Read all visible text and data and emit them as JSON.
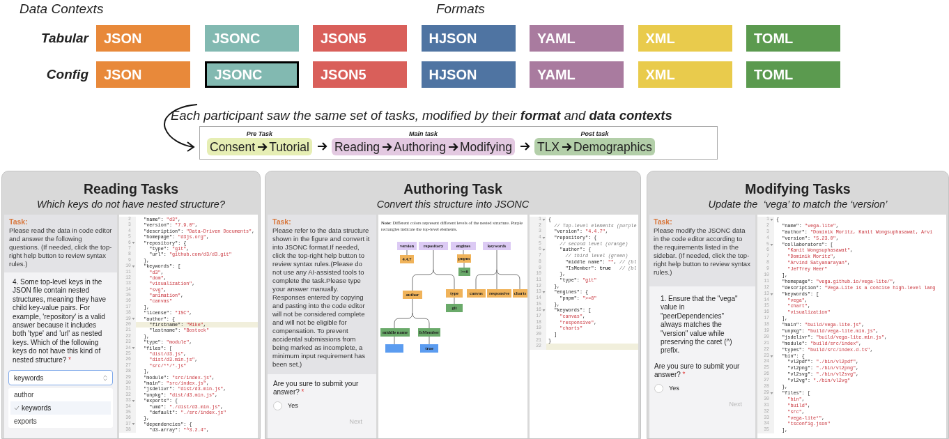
{
  "data_contexts_heading": "Data Contexts",
  "formats_heading": "Formats",
  "contexts": [
    {
      "label": "Tabular",
      "formats": [
        {
          "name": "JSON",
          "color": "#e8893a",
          "selected": false
        },
        {
          "name": "JSONC",
          "color": "#82b9b1",
          "selected": false
        },
        {
          "name": "JSON5",
          "color": "#d95f5a",
          "selected": false
        },
        {
          "name": "HJSON",
          "color": "#4f74a2",
          "selected": false
        },
        {
          "name": "YAML",
          "color": "#a97b9f",
          "selected": false
        },
        {
          "name": "XML",
          "color": "#e9cb4c",
          "selected": false
        },
        {
          "name": "TOML",
          "color": "#5b9a4f",
          "selected": false
        }
      ]
    },
    {
      "label": "Config",
      "formats": [
        {
          "name": "JSON",
          "color": "#e8893a",
          "selected": false
        },
        {
          "name": "JSONC",
          "color": "#82b9b1",
          "selected": true
        },
        {
          "name": "JSON5",
          "color": "#d95f5a",
          "selected": false
        },
        {
          "name": "HJSON",
          "color": "#4f74a2",
          "selected": false
        },
        {
          "name": "YAML",
          "color": "#a97b9f",
          "selected": false
        },
        {
          "name": "XML",
          "color": "#e9cb4c",
          "selected": false
        },
        {
          "name": "TOML",
          "color": "#5b9a4f",
          "selected": false
        }
      ]
    }
  ],
  "caption": "Each participant saw the same set of tasks, modified by their **format** and **data contexts**",
  "flow": [
    {
      "title": "Pre Task",
      "color": "#e6eeb4",
      "steps": [
        "Consent",
        "Tutorial"
      ]
    },
    {
      "title": "Main task",
      "color": "#e3c9e1",
      "steps": [
        "Reading",
        "Authoring",
        "Modifying"
      ]
    },
    {
      "title": "Post task",
      "color": "#b3cfa9",
      "steps": [
        "TLX",
        "Demographics"
      ]
    }
  ],
  "panels": [
    {
      "kind": "reading",
      "title": "Reading Tasks",
      "subtitle": "Which keys do not have nested structure?",
      "task_label": "Task:",
      "task_text": "Please read the data in code editor and answer the following questions. (If needed, click the top-right help button to review syntax rules.)",
      "question": {
        "text": "4. Some top-level keys in the JSON file contain nested structures, meaning they have child key-value pairs. For example, 'repository' is a valid answer because it includes both 'type' and 'url' as nested keys. Which of the following keys do not have this kind of nested structure?",
        "required_mark": "*"
      },
      "answer_field": {
        "value": "keywords"
      },
      "options": [
        {
          "label": "author",
          "selected": false
        },
        {
          "label": "keywords",
          "selected": true
        },
        {
          "label": "exports",
          "selected": false
        }
      ],
      "code": [
        {
          "n": "2",
          "text": "  \"name\": \"d3\","
        },
        {
          "n": "3",
          "text": "  \"version\": \"7.9.0\","
        },
        {
          "n": "4",
          "text": "  \"description\": \"Data-Driven Documents\","
        },
        {
          "n": "5",
          "text": "  \"homepage\": \"d3js.org\","
        },
        {
          "n": "6",
          "text": "  \"repository\": {",
          "fold": true
        },
        {
          "n": "7",
          "text": "    \"type\": \"git\","
        },
        {
          "n": "8",
          "text": "    \"url\": \"github.com/d3/d3.git\""
        },
        {
          "n": "9",
          "text": "  },"
        },
        {
          "n": "10",
          "text": "  \"keywords\": [",
          "fold": true
        },
        {
          "n": "11",
          "text": "    \"d3\","
        },
        {
          "n": "12",
          "text": "    \"dom\","
        },
        {
          "n": "13",
          "text": "    \"visualization\","
        },
        {
          "n": "14",
          "text": "    \"svg\","
        },
        {
          "n": "15",
          "text": "    \"animation\","
        },
        {
          "n": "16",
          "text": "    \"canvas\""
        },
        {
          "n": "17",
          "text": "  ],"
        },
        {
          "n": "18",
          "text": "  \"license\": \"ISC\","
        },
        {
          "n": "19",
          "text": "  \"author\": {",
          "fold": true
        },
        {
          "n": "20",
          "text": "    \"firstname\": \"Mike\",",
          "active": true
        },
        {
          "n": "21",
          "text": "    \"lastname\": \"Bostock\""
        },
        {
          "n": "22",
          "text": "  },"
        },
        {
          "n": "23",
          "text": "  \"type\": \"module\","
        },
        {
          "n": "24",
          "text": "  \"files\": [",
          "fold": true
        },
        {
          "n": "25",
          "text": "    \"dist/d3.js\","
        },
        {
          "n": "26",
          "text": "    \"dist/d3.min.js\","
        },
        {
          "n": "27",
          "text": "    \"src/**/*.js\""
        },
        {
          "n": "28",
          "text": "  ],"
        },
        {
          "n": "29",
          "text": "  \"module\": \"src/index.js\","
        },
        {
          "n": "30",
          "text": "  \"main\": \"src/index.js\","
        },
        {
          "n": "31",
          "text": "  \"jsdelivr\": \"dist/d3.min.js\","
        },
        {
          "n": "32",
          "text": "  \"unpkg\": \"dist/d3.min.js\","
        },
        {
          "n": "33",
          "text": "  \"exports\": {",
          "fold": true
        },
        {
          "n": "34",
          "text": "    \"umd\": \"./dist/d3.min.js\","
        },
        {
          "n": "35",
          "text": "    \"default\": \"./src/index.js\""
        },
        {
          "n": "36",
          "text": "  },"
        },
        {
          "n": "37",
          "text": "  \"dependencies\": {",
          "fold": true
        },
        {
          "n": "38",
          "text": "    \"d3-array\": \"^3.2.4\","
        }
      ]
    },
    {
      "kind": "authoring",
      "title": "Authoring Task",
      "subtitle": "Convert this structure into JSONC",
      "task_label": "Task:",
      "task_text": "Please refer to the data structure shown in the figure and convert it into JSONC format.If needed, click the top-right help button to review syntax rules.(Please do not use any AI-assisted tools to complete the task.Please type your answer manually. Responses entered by copying and pasting into the code editor will not be considered complete and will not be eligible for compensation. To prevent accidental submissions from being marked as incomplete, a minimum input requirement has been set.)",
      "submit": {
        "text": "Are you sure to submit your answer?",
        "required_mark": "*",
        "option": {
          "label": "Yes",
          "checked": false
        },
        "next": {
          "label": "Next",
          "disabled": true
        }
      },
      "note": "**Note**: Different colors represent different levels of the nested structure. Purple rectangles indicate the top-level elements.",
      "diagram_nodes": [
        {
          "label": "version",
          "color": "#dccaf4"
        },
        {
          "label": "4.4.7",
          "color": "#f0b35a"
        },
        {
          "label": "repository",
          "color": "#dccaf4"
        },
        {
          "label": "engines",
          "color": "#dccaf4"
        },
        {
          "label": "pnpm",
          "color": "#f0b35a"
        },
        {
          "label": ">=8",
          "color": "#6aaa6a"
        },
        {
          "label": "keywords",
          "color": "#dccaf4"
        },
        {
          "label": "author",
          "color": "#f0b35a"
        },
        {
          "label": "type",
          "color": "#f0b35a"
        },
        {
          "label": "git",
          "color": "#6aaa6a"
        },
        {
          "label": "canvas",
          "color": "#f0b35a"
        },
        {
          "label": "responsive",
          "color": "#f0b35a"
        },
        {
          "label": "charts",
          "color": "#f0b35a"
        },
        {
          "label": "middle name",
          "color": "#6aaa6a"
        },
        {
          "label": "IsMember",
          "color": "#6aaa6a"
        },
        {
          "color": "#5b9cf0"
        },
        {
          "label": "true",
          "color": "#5b9cf0"
        }
      ],
      "code": [
        {
          "n": "1",
          "text": "{",
          "fold": true
        },
        {
          "n": "2",
          "text": "  // Top-level elements (purple"
        },
        {
          "n": "3",
          "text": "  \"version\": \"4.4.7\","
        },
        {
          "n": "4",
          "text": "  \"repository\": {",
          "fold": true
        },
        {
          "n": "5",
          "text": "    // second level (orange)"
        },
        {
          "n": "6",
          "text": "    \"author\": {",
          "fold": true
        },
        {
          "n": "7",
          "text": "      // third level (green)"
        },
        {
          "n": "8",
          "text": "      \"middle name\": \"\", // (bl"
        },
        {
          "n": "9",
          "text": "      \"IsMember\": true   // (bl"
        },
        {
          "n": "10",
          "text": "    },"
        },
        {
          "n": "11",
          "text": "    \"type\": \"git\""
        },
        {
          "n": "12",
          "text": "  },"
        },
        {
          "n": "13",
          "text": "  \"engines\": {",
          "fold": true
        },
        {
          "n": "14",
          "text": "    \"pnpm\": \">=8\""
        },
        {
          "n": "15",
          "text": "  },"
        },
        {
          "n": "16",
          "text": "  \"keywords\": [",
          "fold": true
        },
        {
          "n": "17",
          "text": "    \"canvas\","
        },
        {
          "n": "18",
          "text": "    \"responsive\","
        },
        {
          "n": "19",
          "text": "    \"charts\""
        },
        {
          "n": "20",
          "text": "  ]"
        },
        {
          "n": "21",
          "text": "}"
        },
        {
          "n": "22",
          "active": true
        }
      ]
    },
    {
      "kind": "modifying",
      "title": "Modifying Tasks",
      "subtitle": "Update the  ‘vega’ to match the ‘version’",
      "task_label": "Task:",
      "task_text": "Please modify the JSONC data in the code editor according to the requirements listed in the sidebar. (If needed, click the top-right help button to review syntax rules.)",
      "question": {
        "text": "1. Ensure that the \"vega\" value in \"peerDependencies\" always matches the \"version\" value while preserving the caret (^) prefix."
      },
      "submit": {
        "text": "Are you sure to submit your answer?",
        "required_mark": "*",
        "option": {
          "label": "Yes",
          "checked": false
        },
        "next": {
          "label": "Next",
          "disabled": true
        }
      },
      "code": [
        {
          "n": "1",
          "text": "{",
          "fold": true
        },
        {
          "n": "2",
          "text": "  \"name\": \"vega-lite\","
        },
        {
          "n": "3",
          "text": "  \"author\": \"Dominik Moritz, Kanit Wongsuphasawat, Arvi"
        },
        {
          "n": "4",
          "text": "  \"version\": \"5.23.0\","
        },
        {
          "n": "5",
          "text": "  \"collaborators\": [",
          "fold": true
        },
        {
          "n": "6",
          "text": "    \"Kanit Wongsuphasawat\","
        },
        {
          "n": "7",
          "text": "    \"Dominik Moritz\","
        },
        {
          "n": "8",
          "text": "    \"Arvind Satyanarayan\","
        },
        {
          "n": "9",
          "text": "    \"Jeffrey Heer\""
        },
        {
          "n": "10",
          "text": "  ],"
        },
        {
          "n": "11",
          "text": "  \"homepage\": \"vega.github.io/vega-lite/\","
        },
        {
          "n": "12",
          "text": "  \"description\": \"Vega-Lite is a concise high-level lang"
        },
        {
          "n": "13",
          "text": "  \"keywords\": [",
          "fold": true
        },
        {
          "n": "14",
          "text": "    \"vega\","
        },
        {
          "n": "15",
          "text": "    \"chart\","
        },
        {
          "n": "16",
          "text": "    \"visualization\""
        },
        {
          "n": "17",
          "text": "  ],"
        },
        {
          "n": "18",
          "text": "  \"main\": \"build/vega-lite.js\","
        },
        {
          "n": "19",
          "text": "  \"unpkg\": \"build/vega-lite.min.js\","
        },
        {
          "n": "20",
          "text": "  \"jsdelivr\": \"build/vega-lite.min.js\","
        },
        {
          "n": "21",
          "text": "  \"module\": \"build/src/index\","
        },
        {
          "n": "22",
          "text": "  \"types\": \"build/src/index.d.ts\","
        },
        {
          "n": "23",
          "text": "  \"bin\": {",
          "fold": true
        },
        {
          "n": "24",
          "text": "    \"vl2pdf\": \"./bin/vl2pdf\","
        },
        {
          "n": "25",
          "text": "    \"vl2png\": \"./bin/vl2png\","
        },
        {
          "n": "26",
          "text": "    \"vl2svg\": \"./bin/vl2svg\","
        },
        {
          "n": "27",
          "text": "    \"vl2vg\": \"./bin/vl2vg\""
        },
        {
          "n": "28",
          "text": "  },"
        },
        {
          "n": "29",
          "text": "  \"files\": [",
          "fold": true
        },
        {
          "n": "30",
          "text": "    \"bin\","
        },
        {
          "n": "31",
          "text": "    \"build\","
        },
        {
          "n": "32",
          "text": "    \"src\","
        },
        {
          "n": "33",
          "text": "    \"vega-lite*\","
        },
        {
          "n": "34",
          "text": "    \"tsconfig.json\""
        },
        {
          "n": "35",
          "text": "  ],"
        }
      ]
    }
  ]
}
